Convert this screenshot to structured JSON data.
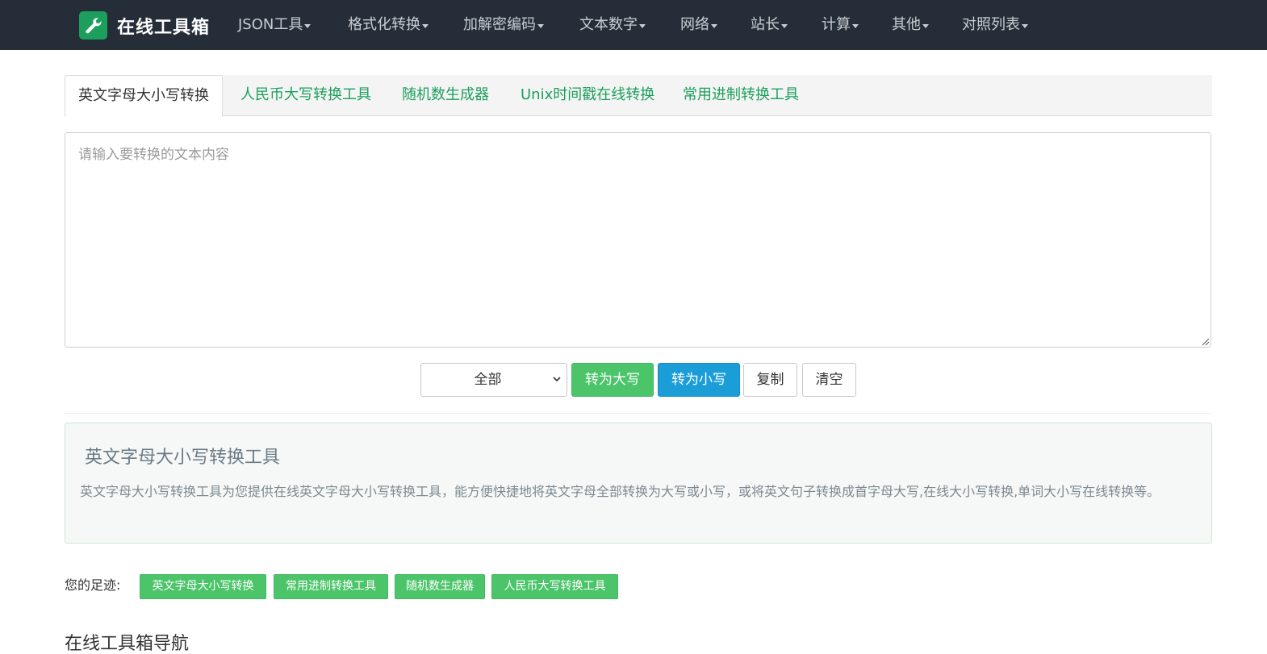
{
  "brand": {
    "name": "在线工具箱"
  },
  "nav": {
    "items": [
      {
        "label": "JSON工具"
      },
      {
        "label": "格式化转换"
      },
      {
        "label": "加解密编码"
      },
      {
        "label": "文本数字"
      },
      {
        "label": "网络"
      },
      {
        "label": "站长"
      },
      {
        "label": "计算"
      },
      {
        "label": "其他"
      },
      {
        "label": "对照列表"
      }
    ]
  },
  "tabs": [
    {
      "label": "英文字母大小写转换",
      "active": true
    },
    {
      "label": "人民币大写转换工具",
      "active": false
    },
    {
      "label": "随机数生成器",
      "active": false
    },
    {
      "label": "Unix时间戳在线转换",
      "active": false
    },
    {
      "label": "常用进制转换工具",
      "active": false
    }
  ],
  "input": {
    "placeholder": "请输入要转换的文本内容",
    "value": ""
  },
  "controls": {
    "mode_select": {
      "selected": "全部"
    },
    "to_upper_label": "转为大写",
    "to_lower_label": "转为小写",
    "copy_label": "复制",
    "clear_label": "清空"
  },
  "info": {
    "title": "英文字母大小写转换工具",
    "description": "英文字母大小写转换工具为您提供在线英文字母大小写转换工具，能方便快捷地将英文字母全部转换为大写或小写，或将英文句子转换成首字母大写,在线大小写转换,单词大小写在线转换等。"
  },
  "footprints": {
    "label": "您的足迹:",
    "tags": [
      {
        "label": "英文字母大小写转换"
      },
      {
        "label": "常用进制转换工具"
      },
      {
        "label": "随机数生成器"
      },
      {
        "label": "人民币大写转换工具"
      }
    ]
  },
  "section": {
    "heading": "在线工具箱导航"
  },
  "colors": {
    "navbar_bg": "#252d38",
    "brand_green": "#1c9f5c",
    "button_green": "#4cc56a",
    "button_blue": "#1b9dd8",
    "tab_link_green": "#1c9f5c"
  },
  "icons": {
    "brand": "wrench-icon",
    "nav_dropdown": "caret-down-icon",
    "select_dropdown": "chevron-down-icon"
  }
}
